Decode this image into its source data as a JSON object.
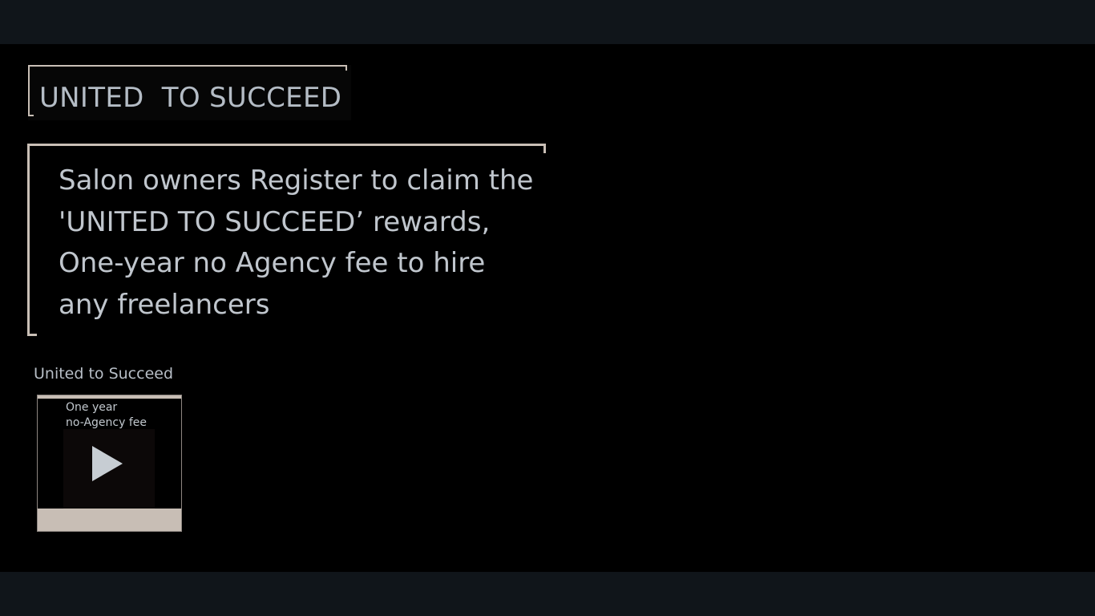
{
  "heading": {
    "title": "UNITED  TO SUCCEED"
  },
  "message": {
    "lines": [
      "Salon owners Register to  claim the",
      "'UNITED TO SUCCEED’ rewards,",
      "One-year no Agency fee to hire",
      "any freelancers"
    ]
  },
  "video": {
    "caption": "United to Succeed",
    "thumbnail_line_1": "One year",
    "thumbnail_line_2": "no-Agency fee",
    "icon": "play-icon"
  },
  "colors": {
    "page_background": "#000000",
    "bar_background": "#10151a",
    "accent_bracket": "#c9bfb6",
    "text": "#c0c6cd"
  }
}
